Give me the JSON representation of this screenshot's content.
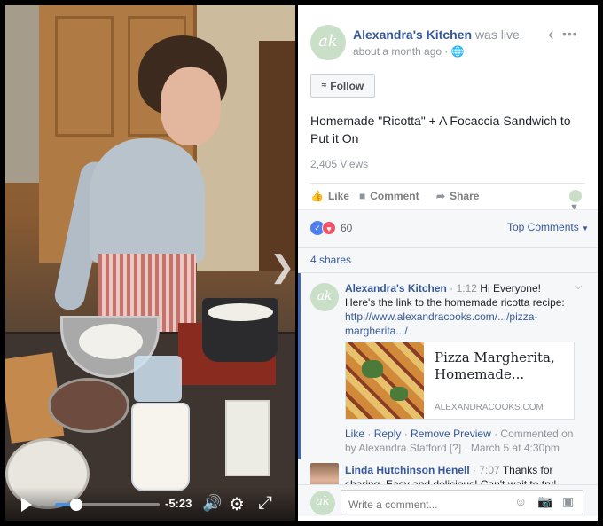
{
  "video": {
    "time_remaining": "-5:23",
    "progress_fraction": 0.2
  },
  "post": {
    "page_name": "Alexandra's Kitchen",
    "status": " was live.",
    "timestamp": "about a month ago",
    "follow_label": "Follow",
    "title": "Homemade \"Ricotta\" + A Focaccia Sandwich to Put it On",
    "views": "2,405 Views",
    "like_label": "Like",
    "comment_label": "Comment",
    "share_label": "Share"
  },
  "reactions": {
    "count": "60",
    "sort_label": "Top Comments",
    "shares": "4 shares"
  },
  "comment1": {
    "author": "Alexandra's Kitchen",
    "time": "1:12",
    "text": "Hi Everyone! Here's the link to the homemade ricotta recipe:",
    "link": "http://www.alexandracooks.com/.../pizza-margherita.../",
    "preview_title": "Pizza Margherita, Homemade...",
    "preview_domain": "ALEXANDRACOOKS.COM",
    "like": "Like",
    "reply": "Reply",
    "remove_preview": "Remove Preview",
    "commented_on": "Commented on by Alexandra Stafford [?] · March 5 at 4:30pm"
  },
  "comment2": {
    "author": "Linda Hutchinson Henell",
    "time": "7:07",
    "text": "Thanks for sharing. Easy and delicious! Can't wait to try!"
  },
  "composer": {
    "placeholder": "Write a comment..."
  },
  "avatar_initials": "ak",
  "colors": {
    "link": "#365899",
    "accent_bar": "#4267b2",
    "progress": "#4a90e2"
  },
  "icons": [
    "play-icon",
    "volume-icon",
    "settings-gear-icon",
    "fullscreen-icon",
    "next-arrow-icon",
    "globe-icon",
    "rss-icon",
    "like-icon",
    "comment-icon",
    "share-icon",
    "chevron-down-icon",
    "more-options-icon",
    "emoji-icon",
    "camera-icon",
    "sticker-icon"
  ]
}
